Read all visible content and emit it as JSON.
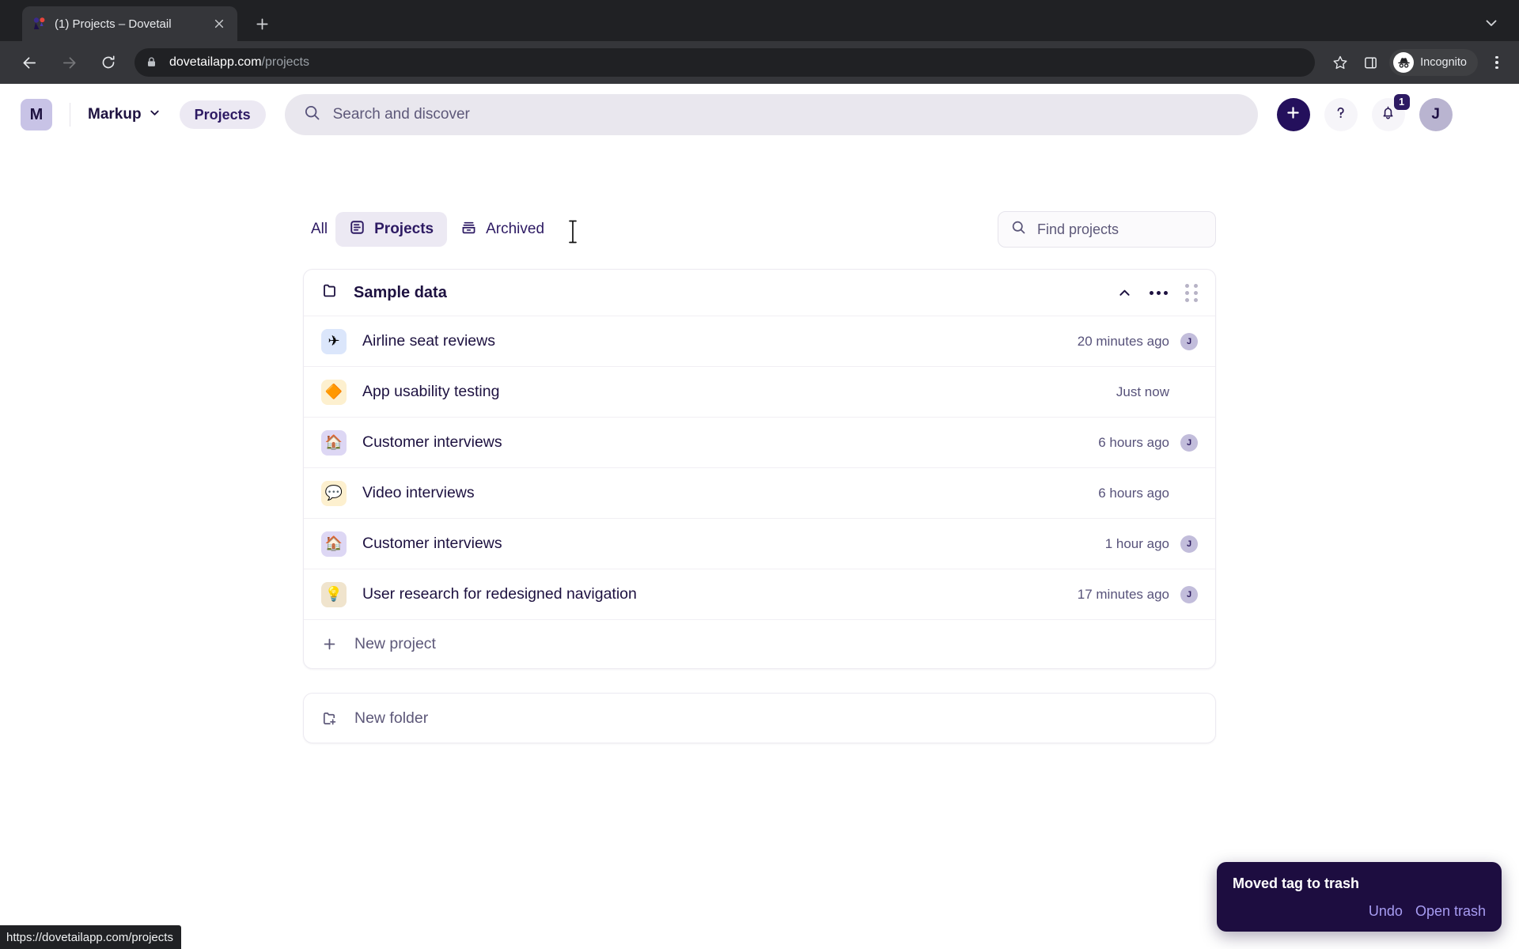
{
  "browser": {
    "tab": {
      "title": "(1) Projects – Dovetail",
      "favicon_icon": "dovetail-logo-icon",
      "close_icon": "close-icon"
    },
    "new_tab_icon": "plus-icon",
    "tabstrip_chevron_icon": "chevron-down-icon",
    "back_icon": "arrow-left-icon",
    "forward_icon": "arrow-right-icon",
    "reload_icon": "reload-icon",
    "omnibox": {
      "lock_icon": "lock-icon",
      "domain": "dovetailapp.com",
      "path": "/projects"
    },
    "bookmark_icon": "star-icon",
    "sidepanel_icon": "side-panel-icon",
    "incognito": {
      "label": "Incognito",
      "icon": "incognito-icon"
    },
    "menu_icon": "kebab-menu-icon",
    "status_url": "https://dovetailapp.com/projects"
  },
  "header": {
    "workspace_initial": "M",
    "workspace_name": "Markup",
    "workspace_chevron_icon": "chevron-down-icon",
    "projects_chip": "Projects",
    "search": {
      "placeholder": "Search and discover",
      "icon": "search-icon"
    },
    "create_button": {
      "label": "+",
      "icon": "plus-icon"
    },
    "help_button": {
      "label": "?",
      "icon": "question-mark-icon"
    },
    "notifications": {
      "icon": "bell-icon",
      "badge": "1"
    },
    "user_avatar": "J"
  },
  "tabs": [
    {
      "label": "All",
      "icon": null,
      "active": false
    },
    {
      "label": "Projects",
      "icon": "project-list-icon",
      "active": true
    },
    {
      "label": "Archived",
      "icon": "archive-icon",
      "active": false
    }
  ],
  "find": {
    "placeholder": "Find projects",
    "icon": "search-icon"
  },
  "folder": {
    "name": "Sample data",
    "icon": "folder-icon",
    "collapse_icon": "chevron-up-icon",
    "more_icon": "more-horizontal-icon",
    "drag_icon": "drag-grip-icon",
    "projects": [
      {
        "emoji": "✈",
        "emoji_bg": "#dbe6fb",
        "name": "Airline seat reviews",
        "time": "20 minutes ago",
        "avatar": "J"
      },
      {
        "emoji": "🔶",
        "emoji_bg": "#fdf0cf",
        "name": "App usability testing",
        "time": "Just now",
        "avatar": null
      },
      {
        "emoji": "🏠",
        "emoji_bg": "#ddd7f4",
        "name": "Customer interviews",
        "time": "6 hours ago",
        "avatar": "J"
      },
      {
        "emoji": "💬",
        "emoji_bg": "#fdf0cf",
        "name": "Video interviews",
        "time": "6 hours ago",
        "avatar": null
      },
      {
        "emoji": "🏠",
        "emoji_bg": "#ddd7f4",
        "name": "Customer interviews",
        "time": "1 hour ago",
        "avatar": "J"
      },
      {
        "emoji": "💡",
        "emoji_bg": "#f0e4cd",
        "name": "User research for redesigned navigation",
        "time": "17 minutes ago",
        "avatar": "J"
      }
    ],
    "new_project": {
      "label": "New project",
      "icon": "plus-icon"
    }
  },
  "new_folder": {
    "label": "New folder",
    "icon": "folder-plus-icon"
  },
  "toast": {
    "title": "Moved tag to trash",
    "undo_label": "Undo",
    "open_trash_label": "Open trash"
  },
  "colors": {
    "brand_dark": "#24105c",
    "accent_chip_bg": "#ece9f3",
    "toast_bg": "#1d0d40",
    "toast_link": "#a79cf2"
  }
}
